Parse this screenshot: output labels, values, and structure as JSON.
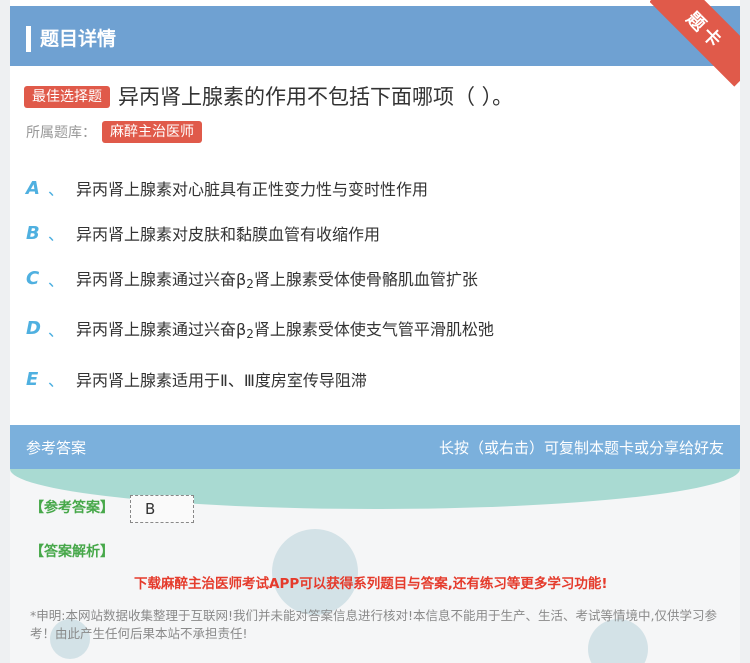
{
  "header": {
    "title": "题目详情"
  },
  "ribbon": {
    "label": "题卡"
  },
  "question": {
    "tag": "最佳选择题",
    "text": "异丙肾上腺素的作用不包括下面哪项（ ）。",
    "bank_label": "所属题库：",
    "bank": "麻醉主治医师"
  },
  "options": [
    {
      "letter": "A",
      "sep": "、",
      "text": "异丙肾上腺素对心脏具有正性变力性与变时性作用"
    },
    {
      "letter": "B",
      "sep": "、",
      "text": "异丙肾上腺素对皮肤和黏膜血管有收缩作用"
    },
    {
      "letter": "C",
      "sep": "、",
      "text_pre": "异丙肾上腺素通过兴奋β",
      "sub": "2",
      "text_post": "肾上腺素受体使骨骼肌血管扩张"
    },
    {
      "letter": "D",
      "sep": "、",
      "text_pre": "异丙肾上腺素通过兴奋β",
      "sub": "2",
      "text_post": "肾上腺素受体使支气管平滑肌松弛"
    },
    {
      "letter": "E",
      "sep": "、",
      "text": "异丙肾上腺素适用于Ⅱ、Ⅲ度房室传导阻滞"
    }
  ],
  "answer": {
    "head_left": "参考答案",
    "head_right": "长按（或右击）可复制本题卡或分享给好友",
    "ref_label": "【参考答案】",
    "ref_value": "B",
    "analysis_label": "【答案解析】",
    "promo": "下载麻醉主治医师考试APP可以获得系列题目与答案,还有练习等更多学习功能!",
    "disclaimer": "*申明:本网站数据收集整理于互联网!我们并未能对答案信息进行核对!本信息不能用于生产、生活、考试等情境中,仅供学习参考！由此产生任何后果本站不承担责任!"
  },
  "colors": {
    "header": "#6fa1d2",
    "accent_red": "#e05a4a",
    "option_letter": "#4fb0e0",
    "label_green": "#47a84a",
    "promo_red": "#e53b2c"
  }
}
